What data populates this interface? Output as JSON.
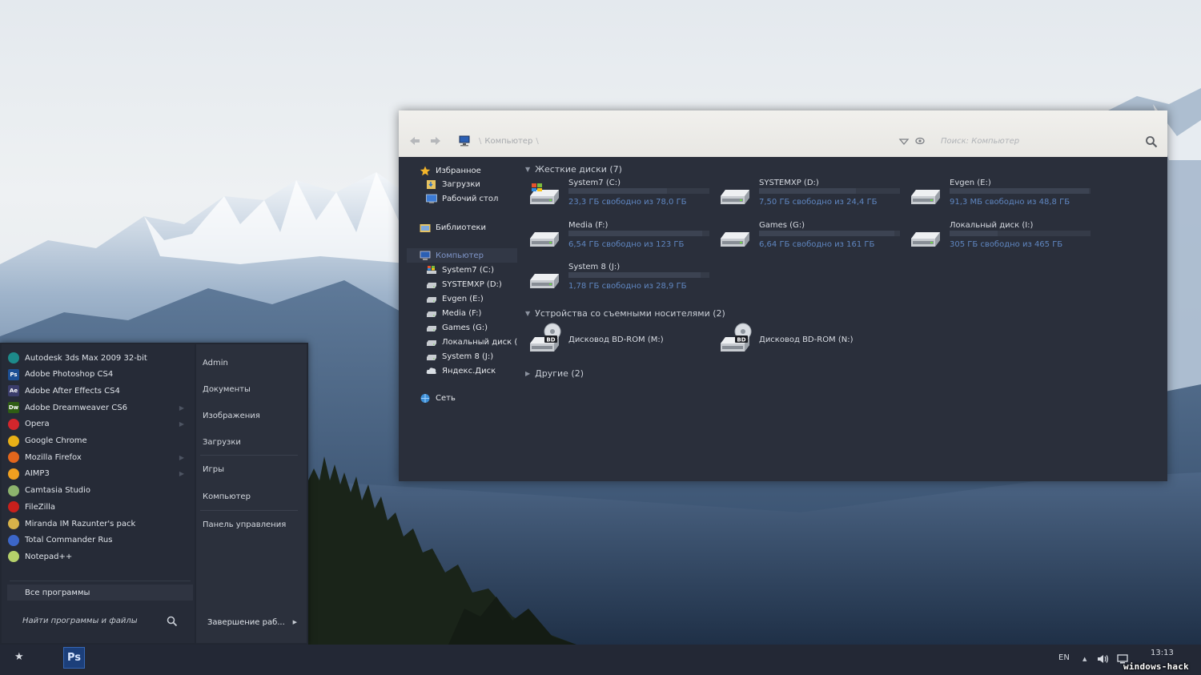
{
  "explorer": {
    "address": {
      "location": "Компьютер",
      "separator": "\\"
    },
    "search_placeholder": "Поиск: Компьютер",
    "nav": {
      "favorites": "Избранное",
      "downloads": "Загрузки",
      "desktop": "Рабочий стол",
      "libraries": "Библиотеки",
      "computer": "Компьютер",
      "drives": [
        "System7 (C:)",
        "SYSTEMXP (D:)",
        "Evgen (E:)",
        "Media (F:)",
        "Games (G:)",
        "Локальный диск (I:)",
        "System 8 (J:)",
        "Яндекс.Диск"
      ],
      "network": "Сеть"
    },
    "groups": {
      "hard_drives": "Жесткие диски (7)",
      "removable": "Устройства со съемными носителями (2)",
      "other": "Другие (2)"
    },
    "hard_drives": [
      {
        "name": "System7 (C:)",
        "free": "23,3 ГБ свободно из 78,0 ГБ",
        "used_fraction": 0.7
      },
      {
        "name": "SYSTEMXP (D:)",
        "free": "7,50 ГБ свободно из 24,4 ГБ",
        "used_fraction": 0.69
      },
      {
        "name": "Evgen (E:)",
        "free": "91,3 МБ свободно из 48,8 ГБ",
        "used_fraction": 0.99
      },
      {
        "name": "Media (F:)",
        "free": "6,54 ГБ свободно из 123 ГБ",
        "used_fraction": 0.95
      },
      {
        "name": "Games (G:)",
        "free": "6,64 ГБ свободно из 161 ГБ",
        "used_fraction": 0.96
      },
      {
        "name": "Локальный диск (I:)",
        "free": "305 ГБ свободно из 465 ГБ",
        "used_fraction": 0.34
      },
      {
        "name": "System 8 (J:)",
        "free": "1,78 ГБ свободно из 28,9 ГБ",
        "used_fraction": 0.94
      }
    ],
    "optical_drives": [
      {
        "name": "Дисковод BD-ROM (M:)",
        "badge": "BD"
      },
      {
        "name": "Дисковод BD-ROM (N:)",
        "badge": "BD"
      }
    ]
  },
  "start_menu": {
    "apps": [
      {
        "label": "Autodesk 3ds Max 2009 32-bit",
        "badge": "",
        "color": "#1d8a8a"
      },
      {
        "label": "Adobe Photoshop CS4",
        "badge": "Ps",
        "color": "#1c4f94"
      },
      {
        "label": "Adobe After Effects CS4",
        "badge": "Ae",
        "color": "#3b3d6b"
      },
      {
        "label": "Adobe Dreamweaver CS6",
        "badge": "Dw",
        "color": "#2f5d14"
      },
      {
        "label": "Opera",
        "badge": "",
        "color": "#d3262c"
      },
      {
        "label": "Google Chrome",
        "badge": "",
        "color": "#e8b017"
      },
      {
        "label": "Mozilla Firefox",
        "badge": "",
        "color": "#e2661c"
      },
      {
        "label": "AIMP3",
        "badge": "",
        "color": "#f0a020"
      },
      {
        "label": "Camtasia Studio",
        "badge": "",
        "color": "#8db36d"
      },
      {
        "label": "FileZilla",
        "badge": "",
        "color": "#c9201c"
      },
      {
        "label": "Miranda IM Razunter's pack",
        "badge": "",
        "color": "#d7b24a"
      },
      {
        "label": "Total Commander Rus",
        "badge": "",
        "color": "#3c66c8"
      },
      {
        "label": "Notepad++",
        "badge": "",
        "color": "#b5d06a"
      }
    ],
    "all_programs": "Все программы",
    "search_placeholder": "Найти программы и файлы",
    "links": [
      "Admin",
      "Документы",
      "Изображения",
      "Загрузки",
      "Игры",
      "Компьютер",
      "Панель управления"
    ],
    "shutdown": "Завершение раб..."
  },
  "taskbar": {
    "pinned_app": "Ps",
    "language": "EN",
    "clock": "13:13"
  },
  "watermark": "windows-hack"
}
